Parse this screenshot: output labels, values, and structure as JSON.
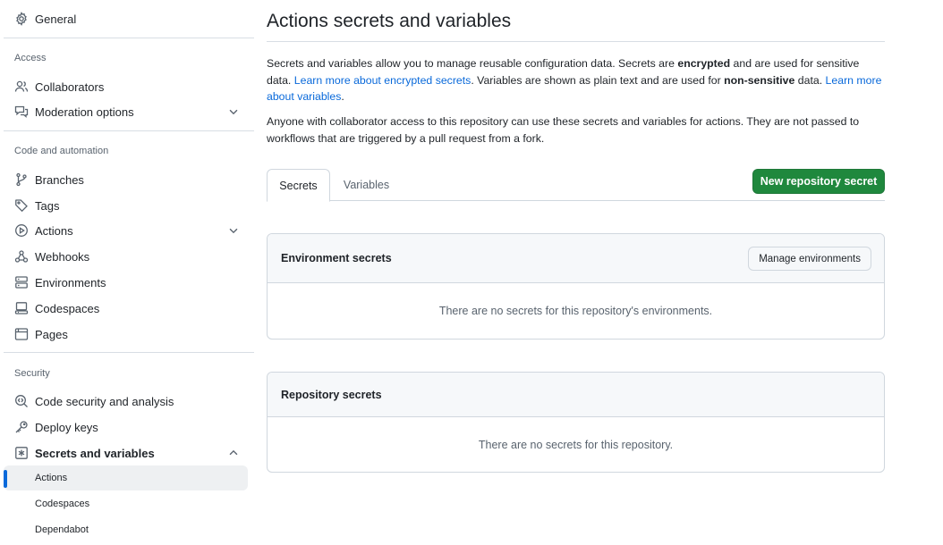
{
  "sidebar": {
    "general": "General",
    "access_heading": "Access",
    "collaborators": "Collaborators",
    "moderation": "Moderation options",
    "code_heading": "Code and automation",
    "branches": "Branches",
    "tags": "Tags",
    "actions": "Actions",
    "webhooks": "Webhooks",
    "environments": "Environments",
    "codespaces": "Codespaces",
    "pages": "Pages",
    "security_heading": "Security",
    "code_security": "Code security and analysis",
    "deploy_keys": "Deploy keys",
    "secrets_vars": "Secrets and variables",
    "sub_actions": "Actions",
    "sub_codespaces": "Codespaces",
    "sub_dependabot": "Dependabot"
  },
  "main": {
    "title": "Actions secrets and variables",
    "p1": {
      "t1": "Secrets and variables allow you to manage reusable configuration data. Secrets are ",
      "b1": "encrypted",
      "t2": " and are used for sensitive data. ",
      "link1": "Learn more about encrypted secrets",
      "t3": ". Variables are shown as plain text and are used for ",
      "b2": "non-sensitive",
      "t4": " data. ",
      "link2": "Learn more about variables",
      "t5": "."
    },
    "p2": "Anyone with collaborator access to this repository can use these secrets and variables for actions. They are not passed to workflows that are triggered by a pull request from a fork.",
    "tabs": [
      "Secrets",
      "Variables"
    ],
    "new_secret_button": "New repository secret",
    "env_box": {
      "title": "Environment secrets",
      "button": "Manage environments",
      "empty": "There are no secrets for this repository's environments."
    },
    "repo_box": {
      "title": "Repository secrets",
      "empty": "There are no secrets for this repository."
    }
  },
  "colors": {
    "accent": "#0969da",
    "primary_button": "#1f883d",
    "border": "#d0d7de",
    "muted_text": "#59636e"
  }
}
